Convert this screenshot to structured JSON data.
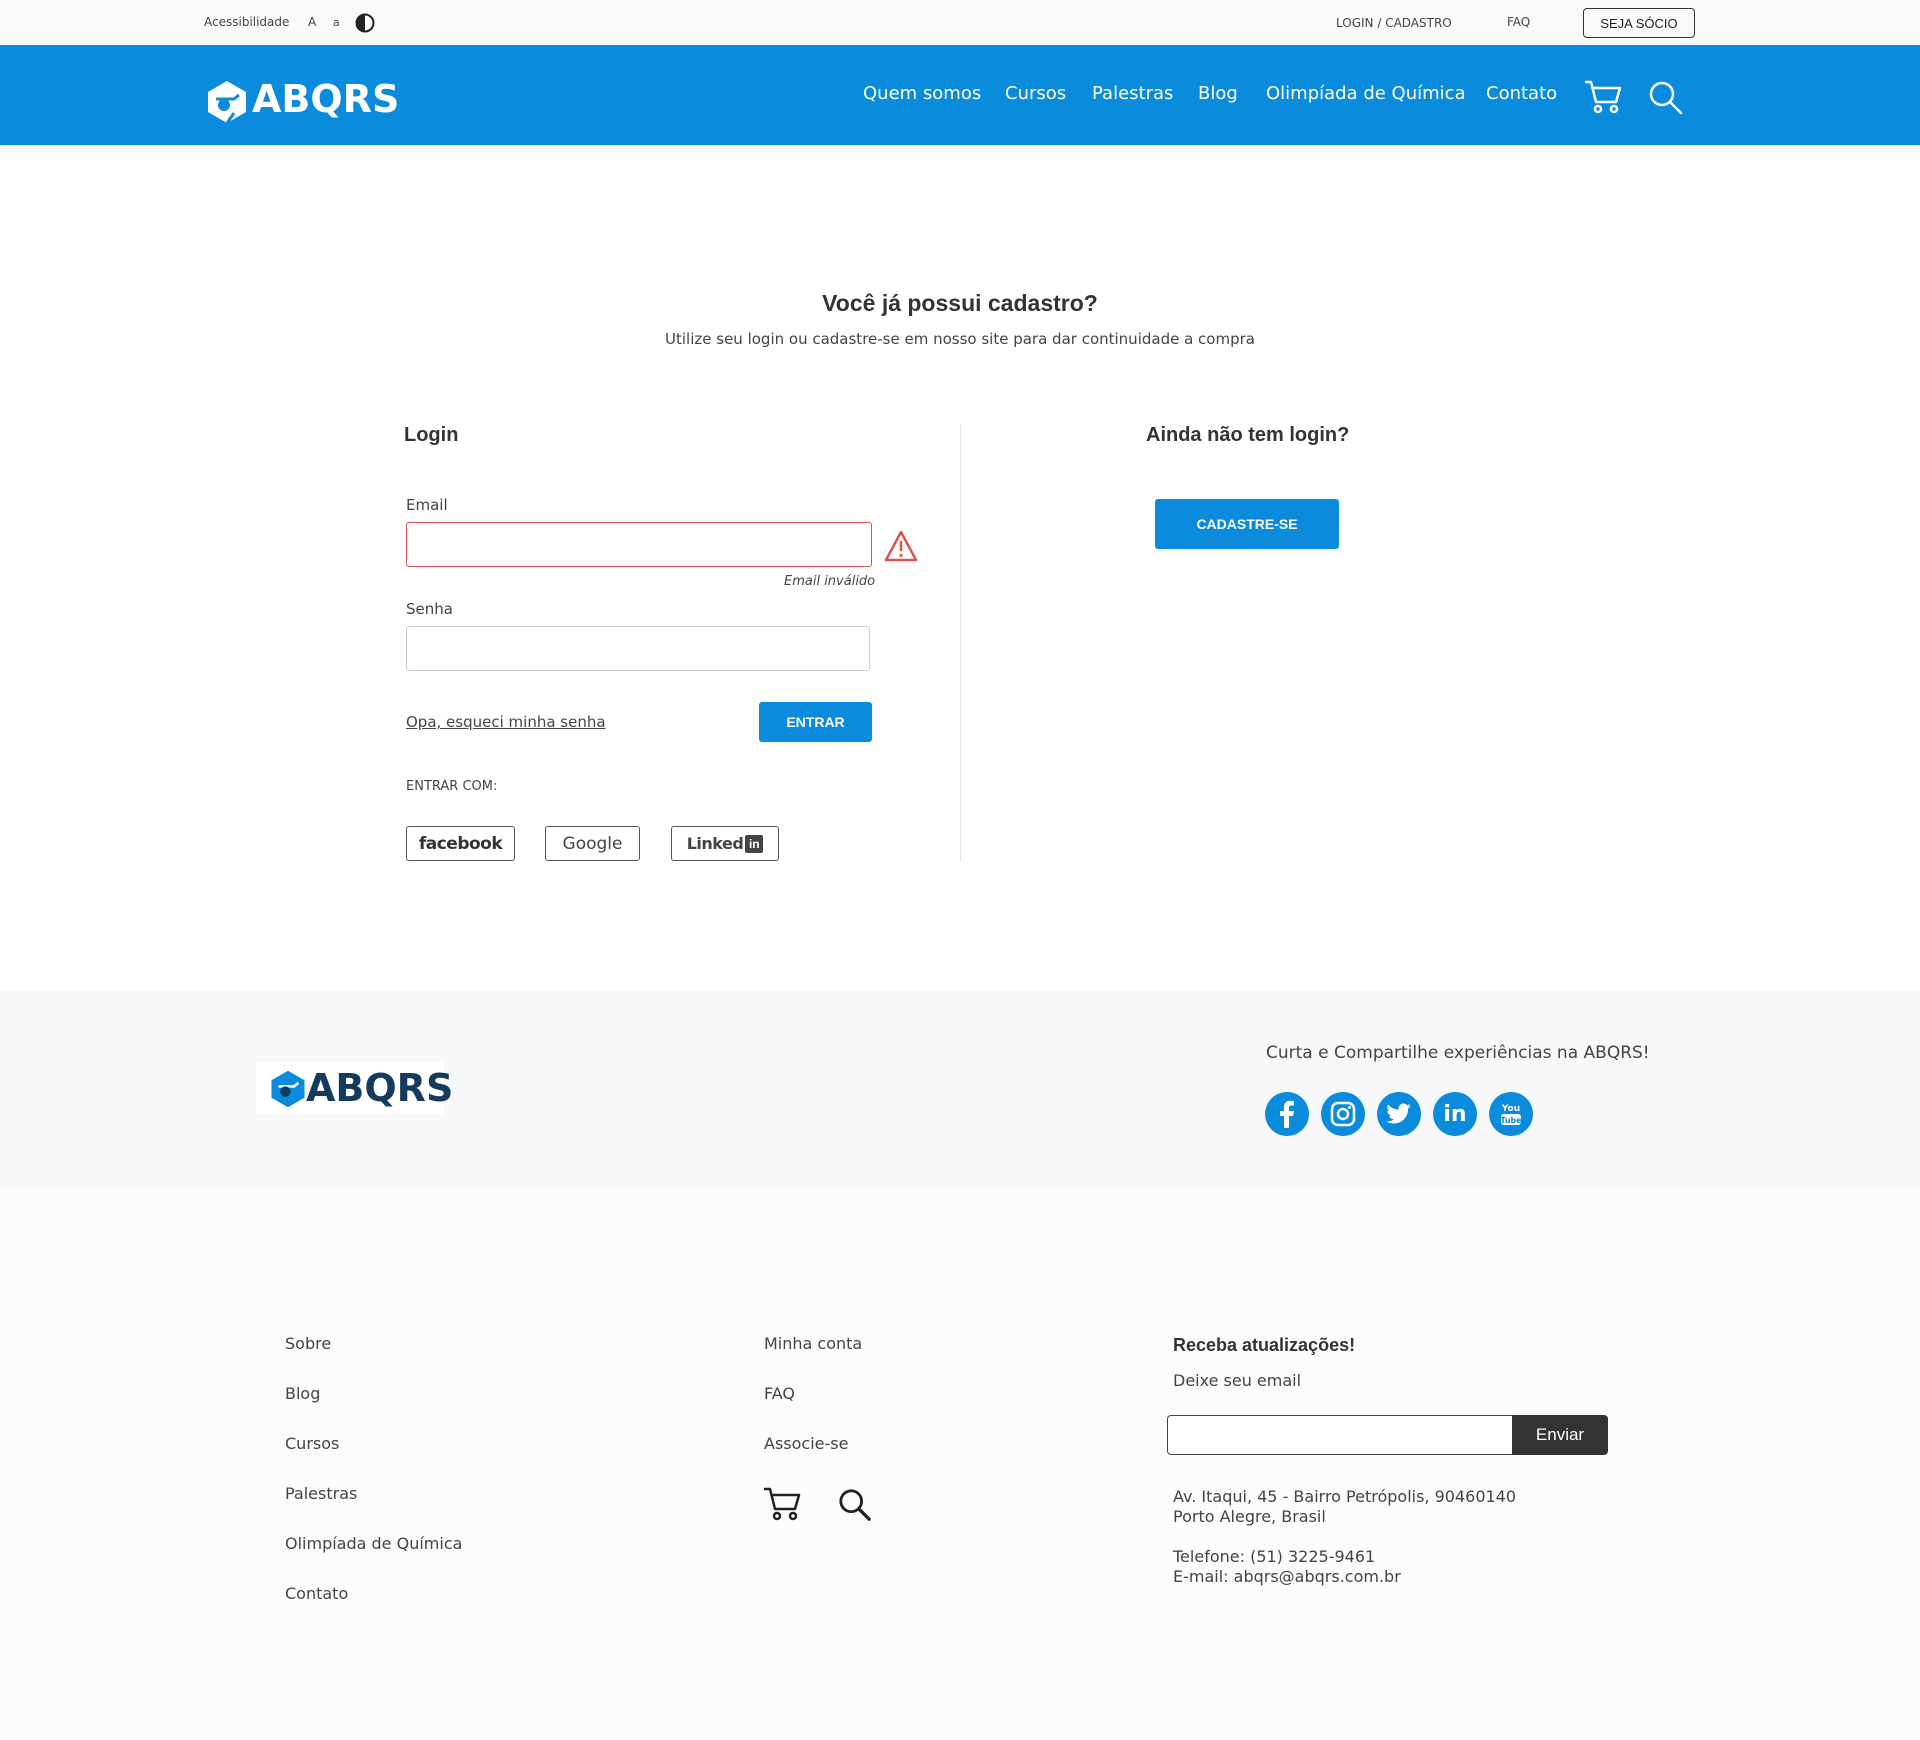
{
  "topbar": {
    "accessibility": "Acessibilidade",
    "font_increase": "A",
    "font_decrease": "a",
    "login": "LOGIN / CADASTRO",
    "faq": "FAQ",
    "member_button": "SEJA SÓCIO"
  },
  "header": {
    "logo_text": "ABQRS",
    "nav": [
      "Quem somos",
      "Cursos",
      "Palestras",
      "Blog",
      "Olimpíada de Química",
      "Contato"
    ]
  },
  "main": {
    "title": "Você já possui cadastro?",
    "subtitle": "Utilize seu login ou cadastre-se em nosso site para dar continuidade a compra",
    "login": {
      "heading": "Login",
      "email_label": "Email",
      "email_value": "",
      "email_error": "Email inválido",
      "password_label": "Senha",
      "password_value": "",
      "forgot_link": "Opa, esqueci minha senha",
      "submit": "ENTRAR",
      "social_label": "ENTRAR COM:",
      "social": [
        "facebook",
        "Google",
        "Linked"
      ]
    },
    "signup": {
      "heading": "Ainda não tem login?",
      "button": "CADASTRE-SE"
    }
  },
  "footer": {
    "logo_text": "ABQRS",
    "share_text": "Curta e Compartilhe experiências na ABQRS!",
    "social_icons": [
      "facebook-icon",
      "instagram-icon",
      "twitter-icon",
      "linkedin-icon",
      "youtube-icon"
    ],
    "col1": [
      "Sobre",
      "Blog",
      "Cursos",
      "Palestras",
      "Olimpíada de Química",
      "Contato"
    ],
    "col2": [
      "Minha conta",
      "FAQ",
      "Associe-se"
    ],
    "newsletter": {
      "heading": "Receba atualizações!",
      "label": "Deixe seu email",
      "value": "",
      "button": "Enviar"
    },
    "address_line1": "Av. Itaqui, 45 - Bairro Petrópolis, 90460140",
    "address_line2": "Porto Alegre, Brasil",
    "phone": "Telefone: (51) 3225-9461",
    "email": "E-mail: abqrs@abqrs.com.br"
  },
  "colors": {
    "brand_blue": "#0a8bdb",
    "footer_logo_navy": "#143a5e",
    "error_red": "#d9534f",
    "dark_button": "#333333"
  }
}
